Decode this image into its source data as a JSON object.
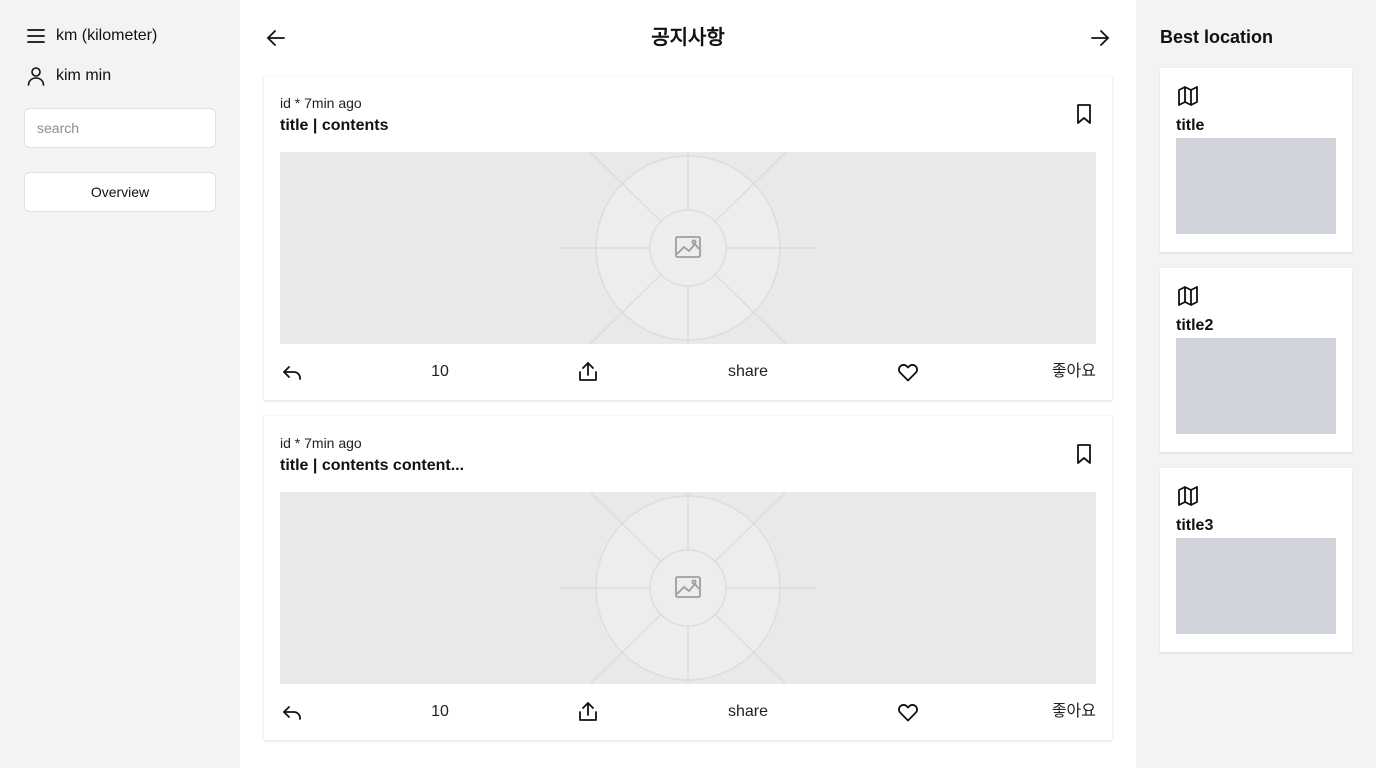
{
  "sidebar": {
    "unit_label": "km (kilometer)",
    "user_name": "kim min",
    "search_placeholder": "search",
    "overview_label": "Overview"
  },
  "header": {
    "title": "공지사항"
  },
  "posts": [
    {
      "meta": "id * 7min ago",
      "title": "title | contents",
      "comment_count": "10",
      "share_label": "share",
      "like_label": "좋아요"
    },
    {
      "meta": "id * 7min ago",
      "title": "title | contents content...",
      "comment_count": "10",
      "share_label": "share",
      "like_label": "좋아요"
    }
  ],
  "best_location": {
    "heading": "Best location",
    "items": [
      {
        "title": "title"
      },
      {
        "title": "title2"
      },
      {
        "title": "title3"
      }
    ]
  },
  "icons": {
    "menu": "menu-icon",
    "user": "user-icon",
    "back": "arrow-left-icon",
    "forward": "arrow-right-icon",
    "bookmark": "bookmark-icon",
    "reply": "reply-icon",
    "share": "share-icon",
    "like": "heart-icon",
    "map": "map-icon",
    "image": "image-placeholder-icon"
  },
  "colors": {
    "side_background": "#f2f3f5",
    "image_placeholder": "#e9e9e9",
    "location_thumbnail": "#d1d5db"
  }
}
